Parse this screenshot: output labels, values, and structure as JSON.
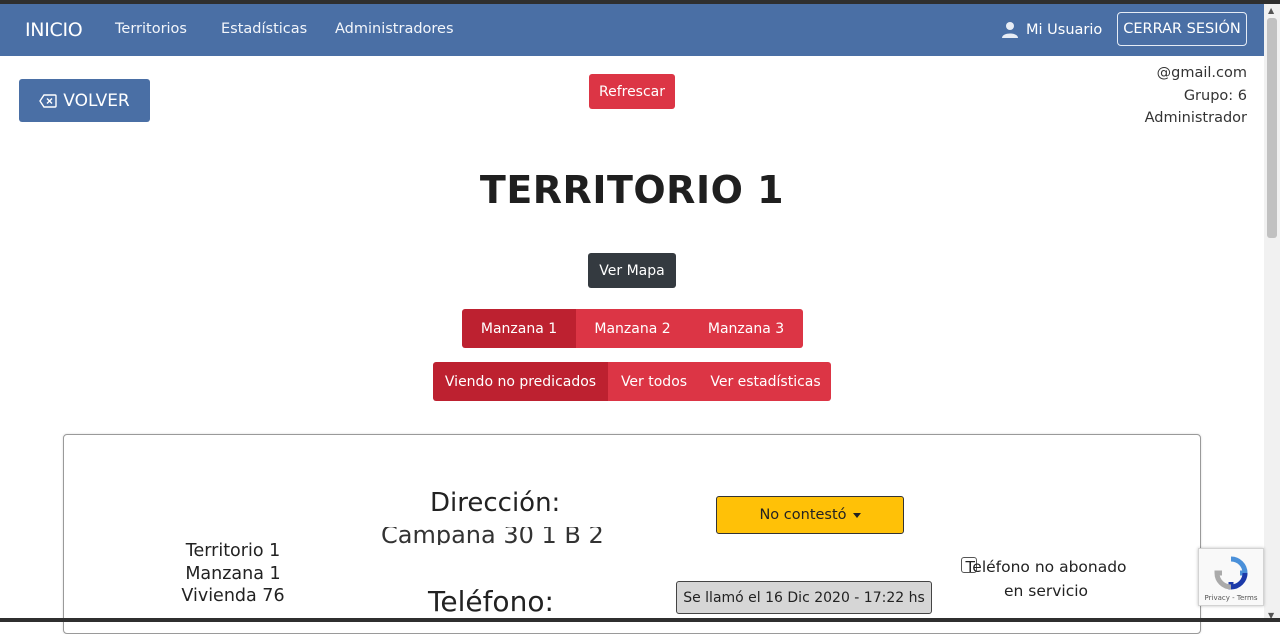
{
  "nav": {
    "brand": "INICIO",
    "links": [
      "Territorios",
      "Estadísticas",
      "Administradores"
    ],
    "user_label": "Mi Usuario",
    "logout_label": "CERRAR SESIÓN"
  },
  "toolbar": {
    "back_label": "VOLVER",
    "refresh_label": "Refrescar"
  },
  "user_info": {
    "email": "@gmail.com",
    "group": "Grupo: 6",
    "role": "Administrador"
  },
  "page": {
    "title": "TERRITORIO 1",
    "map_button": "Ver Mapa"
  },
  "manzanas": {
    "items": [
      "Manzana 1",
      "Manzana 2",
      "Manzana 3"
    ],
    "active": "Manzana 1"
  },
  "filters": {
    "items": [
      "Viendo no predicados",
      "Ver todos",
      "Ver estadísticas"
    ],
    "active": "Viendo no predicados"
  },
  "card": {
    "location_line1": "Territorio 1",
    "location_line2": "Manzana 1",
    "location_line3": "Vivienda 76",
    "address_label": "Dirección:",
    "address_value": "Campana 30 1 B 2",
    "phone_label": "Teléfono:",
    "status_value": "No contestó",
    "call_info": "Se llamó el 16 Dic 2020 - 17:22 hs",
    "not_subscribed_label": "Teléfono no abonado en servicio",
    "not_subscribed_checked": false
  },
  "recaptcha": {
    "links": "Privacy - Terms"
  },
  "colors": {
    "navbar": "#4a6fa5",
    "danger": "#dc3545",
    "danger_active": "#bd2130",
    "dark": "#343a40",
    "warning": "#ffc107"
  }
}
